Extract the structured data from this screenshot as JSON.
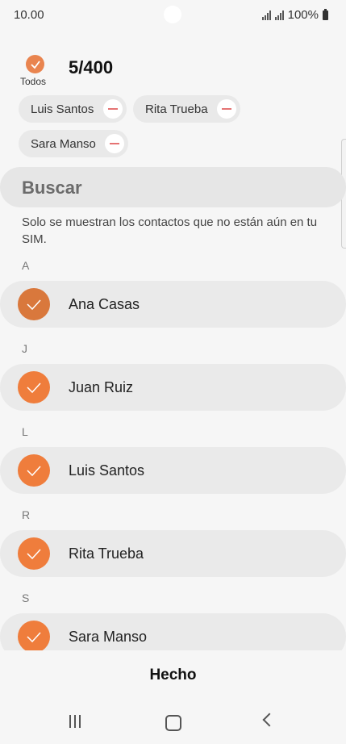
{
  "status": {
    "time": "10.00",
    "battery": "100%"
  },
  "header": {
    "all_label": "Todos",
    "count": "5/400"
  },
  "chips": [
    "Luis Santos",
    "Rita Trueba",
    "Sara Manso"
  ],
  "search": {
    "placeholder": "Buscar"
  },
  "notice": "Solo se muestran los contactos que no están aún en tu SIM.",
  "sections": [
    {
      "letter": "A",
      "contact": "Ana Casas"
    },
    {
      "letter": "J",
      "contact": "Juan Ruiz"
    },
    {
      "letter": "L",
      "contact": "Luis Santos"
    },
    {
      "letter": "R",
      "contact": "Rita Trueba"
    },
    {
      "letter": "S",
      "contact": "Sara Manso"
    }
  ],
  "footer": {
    "done_label": "Hecho"
  },
  "colors": {
    "accent": "#ef7d3c",
    "remove": "#e57373"
  }
}
